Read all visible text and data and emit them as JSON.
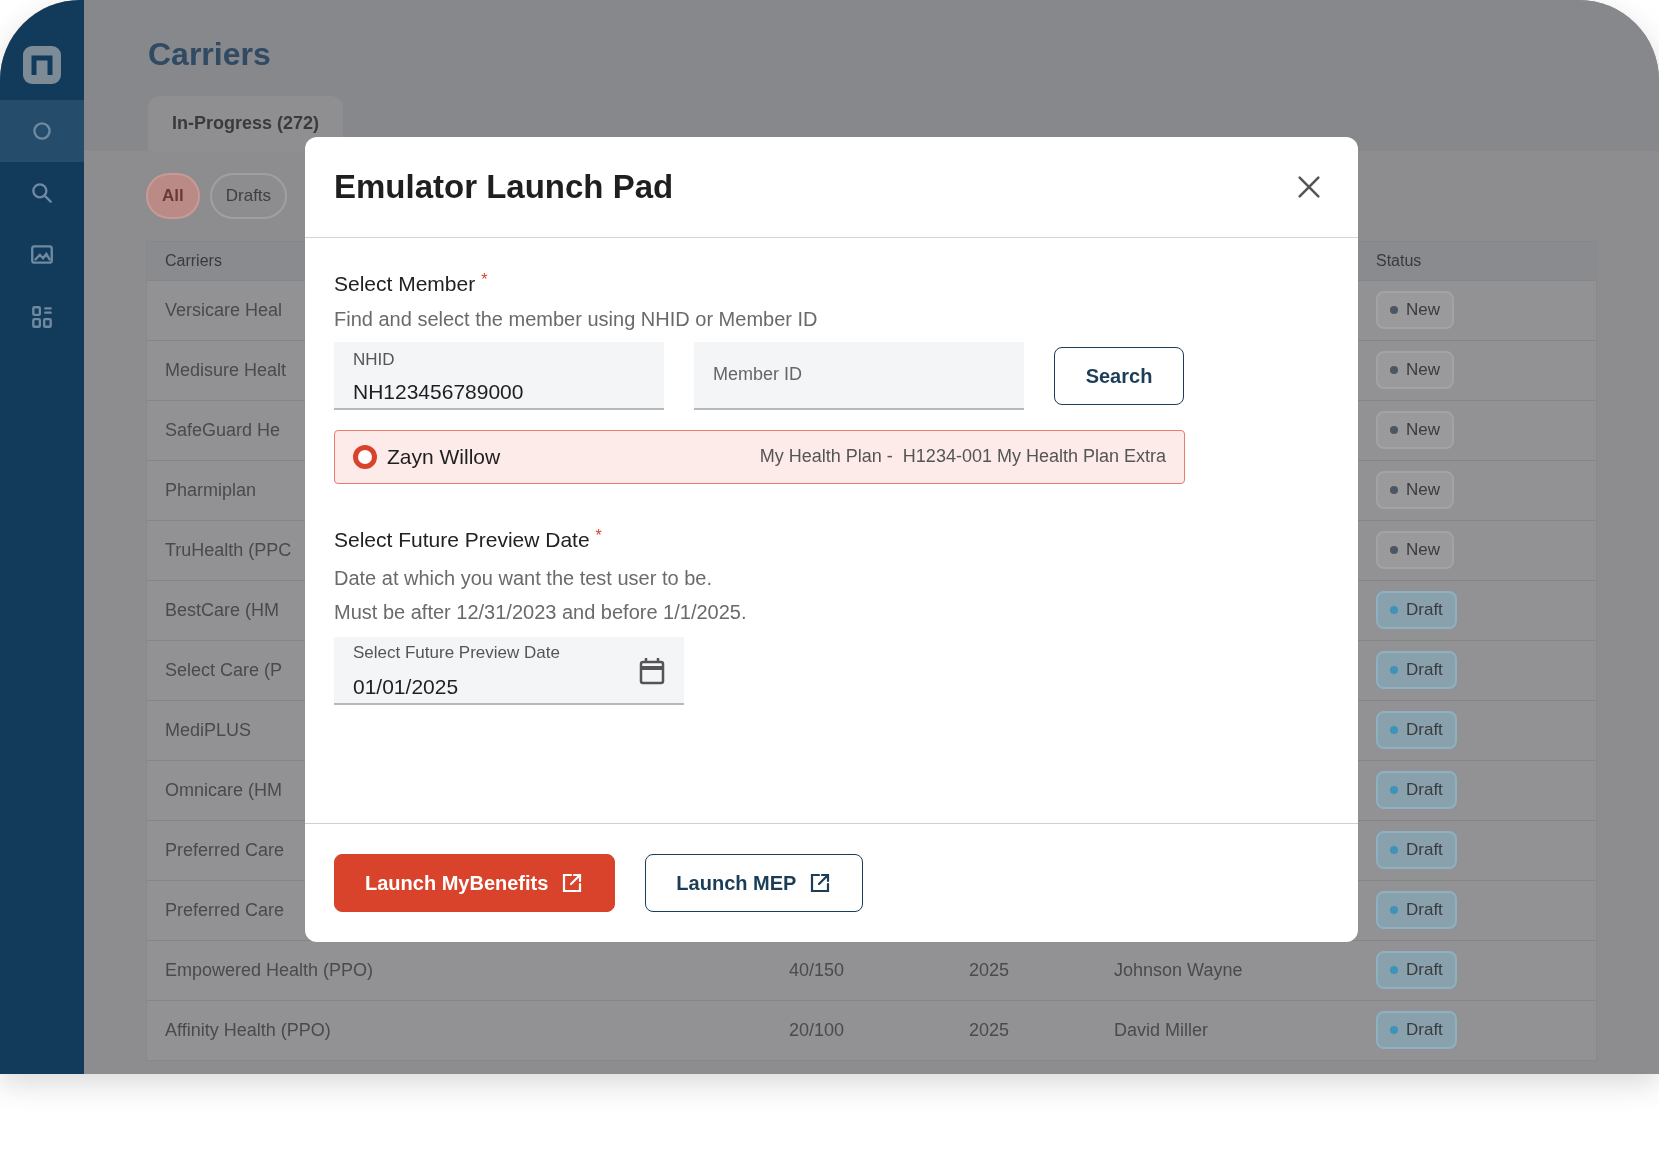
{
  "sidebar": {
    "items": [
      {
        "kind": "circle",
        "selected": true
      },
      {
        "kind": "search",
        "selected": false
      },
      {
        "kind": "gallery",
        "selected": false
      },
      {
        "kind": "grid",
        "selected": false
      }
    ]
  },
  "page": {
    "title": "Carriers",
    "tabs": [
      {
        "label": "In-Progress (272)",
        "selected": true
      }
    ],
    "filters": [
      {
        "label": "All",
        "selected": true
      },
      {
        "label": "Drafts",
        "selected": false
      }
    ],
    "table": {
      "columns": [
        "Carriers",
        "Status"
      ],
      "rows": [
        {
          "carrier": "Versicare Heal",
          "status": {
            "kind": "new",
            "label": "New"
          }
        },
        {
          "carrier": "Medisure Healt",
          "status": {
            "kind": "new",
            "label": "New"
          }
        },
        {
          "carrier": "SafeGuard He",
          "status": {
            "kind": "new",
            "label": "New"
          }
        },
        {
          "carrier": "Pharmiplan",
          "status": {
            "kind": "new",
            "label": "New"
          }
        },
        {
          "carrier": "TruHealth (PPC",
          "status": {
            "kind": "new",
            "label": "New"
          }
        },
        {
          "carrier": "BestCare (HM",
          "status": {
            "kind": "draft",
            "label": "Draft"
          }
        },
        {
          "carrier": "Select Care (P",
          "status": {
            "kind": "draft",
            "label": "Draft"
          }
        },
        {
          "carrier": "MediPLUS",
          "status": {
            "kind": "draft",
            "label": "Draft"
          }
        },
        {
          "carrier": "Omnicare (HM",
          "status": {
            "kind": "draft",
            "label": "Draft"
          }
        },
        {
          "carrier": "Preferred Care",
          "status": {
            "kind": "draft",
            "label": "Draft"
          }
        },
        {
          "carrier": "Preferred Care",
          "status": {
            "kind": "draft",
            "label": "Draft"
          }
        },
        {
          "carrier": "Empowered Health (PPO)",
          "column_2": "40/150",
          "column_3": "2025",
          "column_4": "Johnson Wayne",
          "status": {
            "kind": "draft",
            "label": "Draft"
          }
        },
        {
          "carrier": "Affinity Health (PPO)",
          "column_2": "20/100",
          "column_3": "2025",
          "column_4": "David Miller",
          "status": {
            "kind": "draft",
            "label": "Draft"
          }
        }
      ]
    }
  },
  "dialog": {
    "title": "Emulator Launch Pad",
    "member_section": {
      "label": "Select Member",
      "required_mark": "*",
      "hint": "Find and select the member using NHID or Member ID",
      "nhid_field": {
        "label": "NHID",
        "value": "NH123456789000"
      },
      "member_id_field": {
        "placeholder": "Member ID"
      },
      "search_button": "Search",
      "results": [
        {
          "name": "Zayn Willow",
          "plan": "My Health Plan -  H1234-001 My Health Plan Extra",
          "selected": true
        }
      ]
    },
    "date_section": {
      "label": "Select Future Preview Date",
      "required_mark": "*",
      "hints": [
        "Date at which you want the test user to be.",
        "Must be after 12/31/2023 and before 1/1/2025."
      ],
      "date_field": {
        "label": "Select Future Preview Date",
        "value": "01/01/2025"
      }
    },
    "buttons": [
      {
        "kind": "primary",
        "label": "Launch MyBenefits"
      },
      {
        "kind": "secondary",
        "label": "Launch MEP"
      }
    ]
  }
}
